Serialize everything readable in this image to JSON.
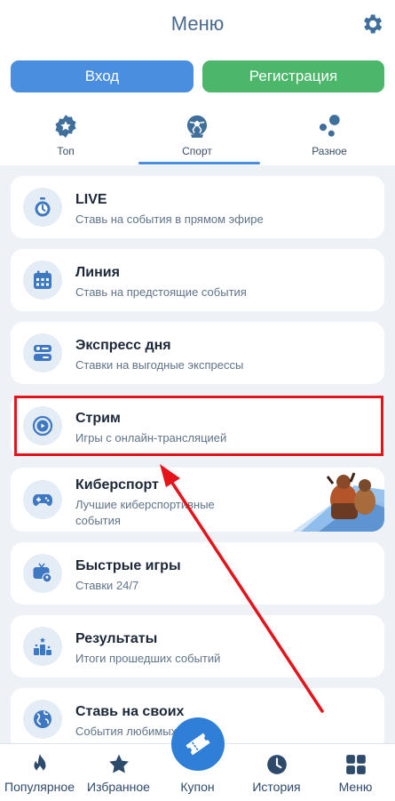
{
  "header": {
    "title": "Меню"
  },
  "auth": {
    "login": "Вход",
    "register": "Регистрация"
  },
  "tabs": [
    {
      "label": "Топ",
      "icon": "badge-star-icon",
      "active": false
    },
    {
      "label": "Спорт",
      "icon": "sports-ball-icon",
      "active": true
    },
    {
      "label": "Разное",
      "icon": "dots-icon",
      "active": false
    }
  ],
  "items": [
    {
      "title": "LIVE",
      "subtitle": "Ставь на события в прямом эфире",
      "icon": "stopwatch-icon"
    },
    {
      "title": "Линия",
      "subtitle": "Ставь на предстоящие события",
      "icon": "calendar-icon"
    },
    {
      "title": "Экспресс дня",
      "subtitle": "Ставки на выгодные экспрессы",
      "icon": "toggles-icon"
    },
    {
      "title": "Стрим",
      "subtitle": "Игры с онлайн-трансляцией",
      "icon": "play-icon"
    },
    {
      "title": "Киберспорт",
      "subtitle": "Лучшие киберспортивные события",
      "icon": "gamepad-icon"
    },
    {
      "title": "Быстрые игры",
      "subtitle": "Ставки 24/7",
      "icon": "tv-ball-icon"
    },
    {
      "title": "Результаты",
      "subtitle": "Итоги прошедших событий",
      "icon": "podium-icon"
    },
    {
      "title": "Ставь на своих",
      "subtitle": "События любимых",
      "icon": "globe-icon"
    }
  ],
  "bottom_nav": [
    {
      "label": "Популярное",
      "icon": "flame-icon"
    },
    {
      "label": "Избранное",
      "icon": "star-icon"
    },
    {
      "label": "Купон",
      "icon": "ticket-icon"
    },
    {
      "label": "История",
      "icon": "clock-icon"
    },
    {
      "label": "Меню",
      "icon": "grid-icon"
    }
  ],
  "colors": {
    "accent": "#4a8ee0",
    "register": "#4cb66a",
    "highlight": "#e5141b",
    "arrow": "#e5141b"
  }
}
